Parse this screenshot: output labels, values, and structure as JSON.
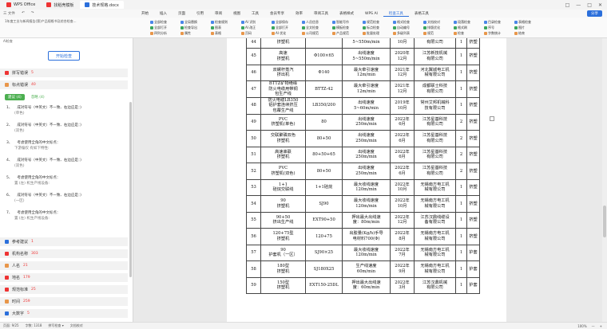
{
  "titlebar": {
    "tabs": [
      {
        "label": "WPS Office"
      },
      {
        "label": "找稻壳模板"
      },
      {
        "label": "技术规格.docx"
      }
    ],
    "right_icons": [
      "□",
      "—",
      "□",
      "✕"
    ]
  },
  "menubar": {
    "left_items": [
      "三 文件",
      "↶",
      "↷"
    ],
    "items": [
      "开始",
      "插入",
      "页面",
      "引用",
      "审阅",
      "视图",
      "工具",
      "会员专享",
      "效率",
      "审阅工具",
      "表格样式",
      "WPS AI",
      "检查工具",
      "表格工具"
    ],
    "active": "检查工具",
    "share_label": "分享"
  },
  "ribbon": {
    "doc_info": "1年度工业与新闻报告(第)产品规格书及综合检查...",
    "groups": [
      [
        "全部检查",
        "全部打开",
        "四列分析"
      ],
      [
        "全局替换",
        "检查导出",
        "属性"
      ],
      [
        "检查规则",
        "图表",
        "表格"
      ],
      [
        "AI 识别",
        "AI 改正",
        "页码"
      ],
      [
        "全部保存",
        "全部打开",
        "AI 优化"
      ],
      [
        "人员信息",
        "全文检查",
        "公司规范"
      ],
      [
        "智能写作",
        "模板检查",
        "产品规范"
      ],
      [
        "规范检查",
        "标点检查",
        "批量处理"
      ],
      [
        "格式检查",
        "自动编号",
        "多级列表"
      ],
      [
        "文档校对",
        "排版优化",
        "规范"
      ],
      [
        "段落检查",
        "格式刷",
        "检查"
      ],
      [
        "目录检查",
        "序号",
        "字数统计"
      ],
      [
        "表格检查",
        "图片",
        "结束"
      ]
    ]
  },
  "panel": {
    "header": "AI检查",
    "start_button": "开始检查",
    "sections": [
      {
        "label": "拼写错误",
        "count": "5",
        "color": "#e33"
      },
      {
        "label": "标点错误",
        "count": "40",
        "color": "#e33"
      }
    ],
    "subtabs": [
      "建议 (4)",
      "忽略 (4)"
    ],
    "errors": [
      {
        "num": "1、",
        "title": "成对符号（中英文）不一致、右边应是：)",
        "sub": "(单色)"
      },
      {
        "num": "2、",
        "title": "成对符号（中英文）不一致、右边应是：)",
        "sub": "(双色)"
      },
      {
        "num": "3、",
        "title": "考虑使用全角的中文标点：",
        "sub": "下游偏仅 有如下特性:"
      },
      {
        "num": "4、",
        "title": "成对符号（中英文）不一致、右边应是：)",
        "sub": "(双色)"
      },
      {
        "num": "5、",
        "title": "考虑使用全角的中文标点：",
        "sub": "置 (左) 机生产线设备:"
      },
      {
        "num": "6、",
        "title": "成对符号（中英文）不一致、右边应是：)",
        "sub": "(一区)"
      },
      {
        "num": "7、",
        "title": "考虑使用全角的中文标点：",
        "sub": "置 (左) 机生产线设备:"
      }
    ],
    "bottom_sections": [
      {
        "label": "参考建议",
        "count": "1",
        "color": "#2b6fdb"
      },
      {
        "label": "机构名称",
        "count": "303",
        "color": "#e33"
      },
      {
        "label": "人名",
        "count": "21",
        "color": "#e8964a"
      },
      {
        "label": "地名",
        "count": "179",
        "color": "#e33"
      },
      {
        "label": "规范标准",
        "count": "25",
        "color": "#e33"
      },
      {
        "label": "时间",
        "count": "259",
        "color": "#e8964a"
      },
      {
        "label": "大数字",
        "count": "5",
        "color": "#2b6fdb"
      }
    ]
  },
  "status": {
    "left": [
      "页面: 9/25",
      "字数: 1318",
      "拼写检查 ▾",
      "文档校对"
    ],
    "right": [
      "100%",
      "—",
      "+"
    ]
  },
  "table": {
    "rows": [
      {
        "no": "44",
        "name": "挤塑机",
        "spec": "",
        "param": "5~550m/min",
        "date": "10月",
        "maker": "有限公司",
        "qty": "1",
        "type": "挤塑"
      },
      {
        "no": "45",
        "name": "高速\n挤塑机",
        "spec": "Φ100×65",
        "param": "出线速度\n5~550m/min",
        "date": "2020年\n12月",
        "maker": "江苏新技机械\n有限公司",
        "qty": "1",
        "type": "挤塑"
      },
      {
        "no": "46",
        "name": "双螺杆蒸汽\n挤出机",
        "spec": "Φ140",
        "param": "最大牵引速度\n12m/min",
        "date": "2021年\n12月",
        "maker": "河北翼城电工机\n械有限公司",
        "qty": "1",
        "type": "挤塑"
      },
      {
        "no": "47",
        "name": "BTTZ矿物绝缘\n防火电缆用带铜\n包生产线",
        "spec": "BTTZ-42",
        "param": "最大牵引速度\n12m/min",
        "date": "2021年\n12月",
        "maker": "成都联士科技\n有限公司",
        "qty": "1",
        "type": "挤塑"
      },
      {
        "no": "48",
        "name": "防火电缆LB350\n铝护套连续挤压\n包覆生产线",
        "spec": "LB350/200",
        "param": "出线速度\n5~60m/min",
        "date": "2019年\n10月",
        "maker": "常州艾邦机械科\n技有限公司",
        "qty": "1",
        "type": "挤塑"
      },
      {
        "no": "49",
        "name": "PVC\n挤塑机(单色)",
        "spec": "80",
        "param": "出线速度\n250m/min",
        "date": "2022年\n6月",
        "maker": "江苏星基科技\n有限公司",
        "qty": "2",
        "type": "挤塑"
      },
      {
        "no": "50",
        "name": "交联聚磷双色\n挤塑机",
        "spec": "80+50",
        "param": "出线速度\n250m/min",
        "date": "2022年\n6月",
        "maker": "江苏星基科技\n有限公司",
        "qty": "2",
        "type": "挤塑"
      },
      {
        "no": "51",
        "name": "高速串联\n挤塑机",
        "spec": "80+50+65",
        "param": "出线速度\n250m/min",
        "date": "2022年\n6月",
        "maker": "江苏星基科技\n有限公司",
        "qty": "2",
        "type": "挤塑"
      },
      {
        "no": "52",
        "name": "PVC\n挤塑机(双色)",
        "spec": "80+50",
        "param": "出线速度\n250m/min",
        "date": "2022年\n6月",
        "maker": "江苏星基科技\n有限公司",
        "qty": "2",
        "type": "挤塑"
      },
      {
        "no": "53",
        "name": "1+1\n硅烷交联线",
        "spec": "1+1硅烷",
        "param": "最大收线速度\n120m/min",
        "date": "2022年\n10月",
        "maker": "无锡南方电工机\n械有限公司",
        "qty": "1",
        "type": "挤塑"
      },
      {
        "no": "54",
        "name": "90\n挤塑机",
        "spec": "SJ90",
        "param": "最大收线速度\n120m/min",
        "date": "2022年\n10月",
        "maker": "无锡南方电工机\n械有限公司",
        "qty": "1",
        "type": "挤塑"
      },
      {
        "no": "55",
        "name": "90+50\n挤出生产线",
        "spec": "EXT90+50",
        "param": "押出最大出线速\n度：80m/min",
        "date": "2022年\n12月",
        "maker": "江苏汉鼎线缆设\n备有限公司",
        "qty": "1",
        "type": "挤塑"
      },
      {
        "no": "56",
        "name": "120+75型\n挤塑机",
        "spec": "120+75",
        "param": "出胶量(Kg/h)手导\n电材料700(Φ)",
        "date": "2022年\n8月",
        "maker": "无锡南方电工机\n械有限公司",
        "qty": "1",
        "type": "挤塑"
      },
      {
        "no": "57",
        "name": "90\n护套机（一区）",
        "spec": "SJ90×25",
        "param": "最大收线速度\n120m/min",
        "date": "2022年\n7月",
        "maker": "无锡南方电工机\n械有限公司",
        "qty": "1",
        "type": "护套"
      },
      {
        "no": "58",
        "name": "180型\n挤塑机",
        "spec": "SJ180X25",
        "param": "生产线速度\n60m/min",
        "date": "2022年\n9月",
        "maker": "无锡南方电工机\n械有限公司",
        "qty": "1",
        "type": "护套"
      },
      {
        "no": "59",
        "name": "150型\n挤塑机",
        "spec": "EXT150-25DL",
        "param": "押出最大出线速\n度：60m/min",
        "date": "2022年\n3月",
        "maker": "江苏汉鼎机械\n有限公司",
        "qty": "1",
        "type": "护套"
      }
    ]
  }
}
